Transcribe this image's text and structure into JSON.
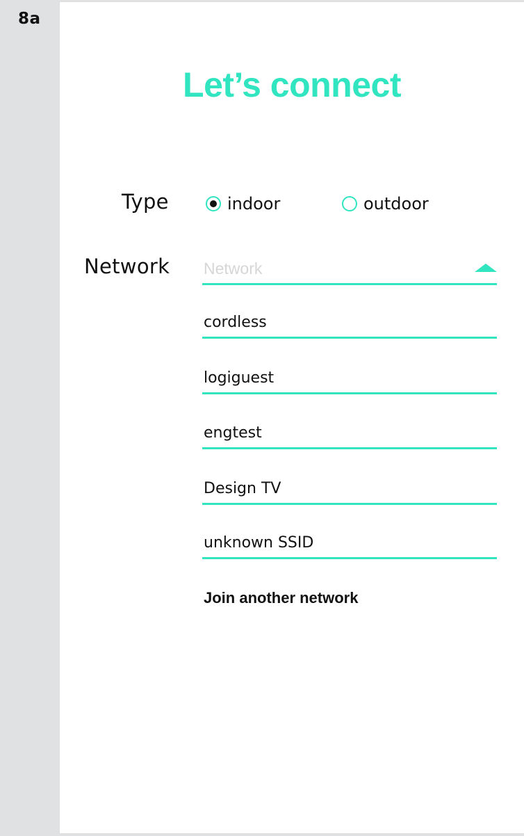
{
  "step": {
    "label": "8a"
  },
  "title": "Let’s connect",
  "type": {
    "label": "Type",
    "options": [
      {
        "label": "indoor",
        "selected": true
      },
      {
        "label": "outdoor",
        "selected": false
      }
    ]
  },
  "network": {
    "label": "Network",
    "placeholder": "Network",
    "dropdown_open": true,
    "items": [
      "cordless",
      "logiguest",
      "engtest",
      "Design TV",
      "unknown SSID"
    ],
    "join_label": "Join another network"
  },
  "colors": {
    "accent": "#31e5c0",
    "background": "#e0e1e3",
    "panel": "#ffffff",
    "text": "#111111",
    "placeholder": "#d6d6d6"
  }
}
